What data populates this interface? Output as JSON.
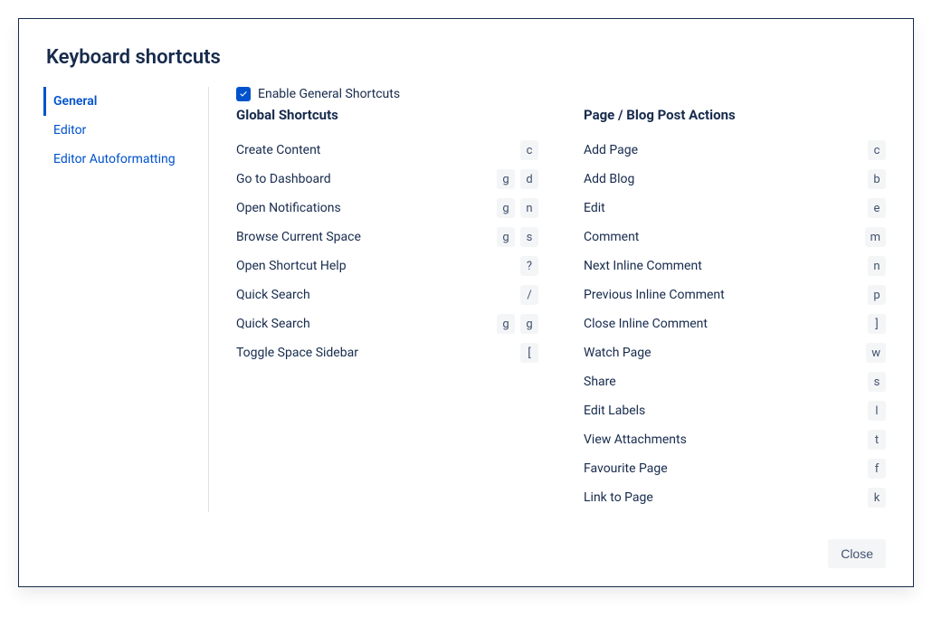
{
  "title": "Keyboard shortcuts",
  "sidebar": {
    "items": [
      {
        "label": "General",
        "active": true
      },
      {
        "label": "Editor",
        "active": false
      },
      {
        "label": "Editor Autoformatting",
        "active": false
      }
    ]
  },
  "enable": {
    "label": "Enable General Shortcuts",
    "checked": true
  },
  "sections": [
    {
      "title": "Global Shortcuts",
      "items": [
        {
          "label": "Create Content",
          "keys": [
            "c"
          ]
        },
        {
          "label": "Go to Dashboard",
          "keys": [
            "g",
            "d"
          ]
        },
        {
          "label": "Open Notifications",
          "keys": [
            "g",
            "n"
          ]
        },
        {
          "label": "Browse Current Space",
          "keys": [
            "g",
            "s"
          ]
        },
        {
          "label": "Open Shortcut Help",
          "keys": [
            "?"
          ]
        },
        {
          "label": "Quick Search",
          "keys": [
            "/"
          ]
        },
        {
          "label": "Quick Search",
          "keys": [
            "g",
            "g"
          ]
        },
        {
          "label": "Toggle Space Sidebar",
          "keys": [
            "["
          ]
        }
      ]
    },
    {
      "title": "Page / Blog Post Actions",
      "items": [
        {
          "label": "Add Page",
          "keys": [
            "c"
          ]
        },
        {
          "label": "Add Blog",
          "keys": [
            "b"
          ]
        },
        {
          "label": "Edit",
          "keys": [
            "e"
          ]
        },
        {
          "label": "Comment",
          "keys": [
            "m"
          ]
        },
        {
          "label": "Next Inline Comment",
          "keys": [
            "n"
          ]
        },
        {
          "label": "Previous Inline Comment",
          "keys": [
            "p"
          ]
        },
        {
          "label": "Close Inline Comment",
          "keys": [
            "]"
          ]
        },
        {
          "label": "Watch Page",
          "keys": [
            "w"
          ]
        },
        {
          "label": "Share",
          "keys": [
            "s"
          ]
        },
        {
          "label": "Edit Labels",
          "keys": [
            "l"
          ]
        },
        {
          "label": "View Attachments",
          "keys": [
            "t"
          ]
        },
        {
          "label": "Favourite Page",
          "keys": [
            "f"
          ]
        },
        {
          "label": "Link to Page",
          "keys": [
            "k"
          ]
        }
      ]
    }
  ],
  "footer": {
    "close_label": "Close"
  }
}
